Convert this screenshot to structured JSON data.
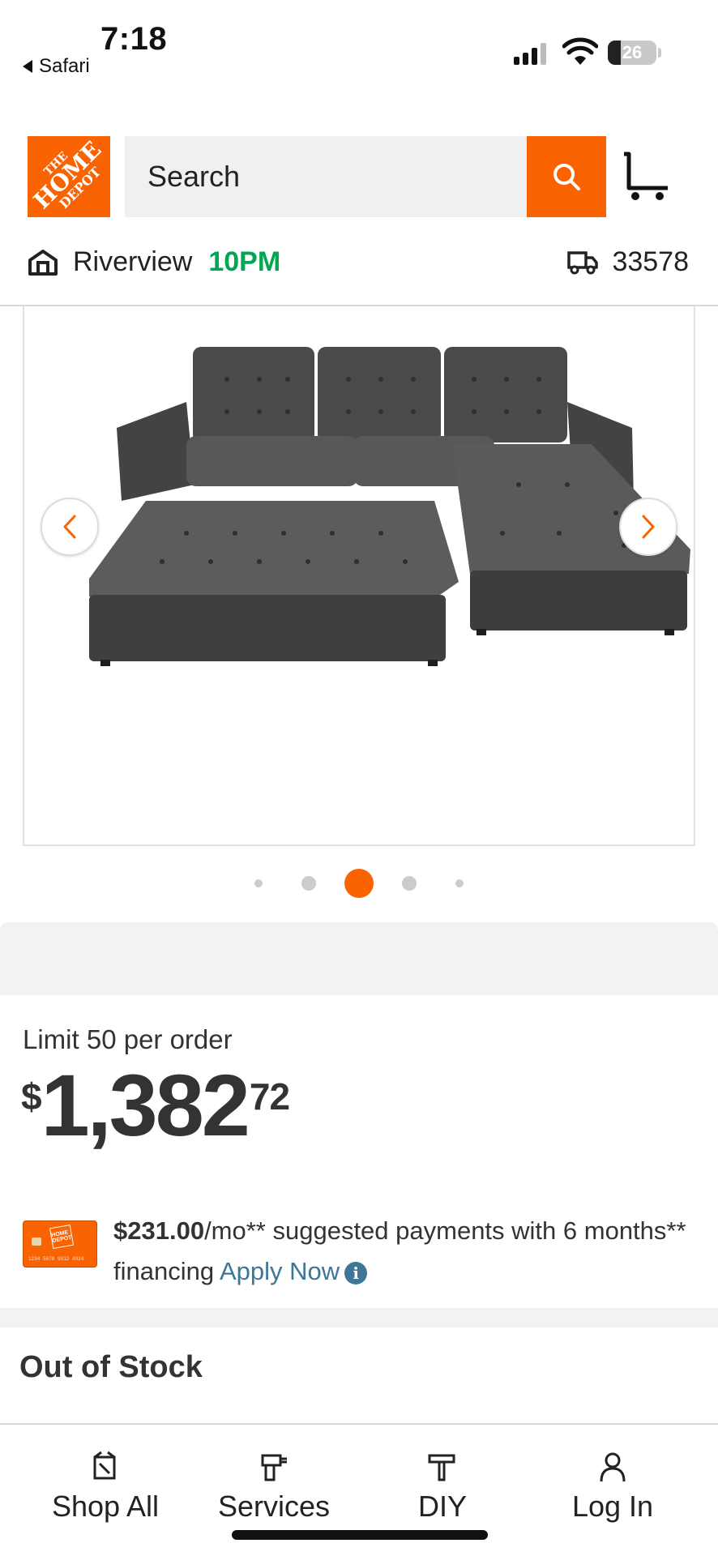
{
  "status_bar": {
    "time": "7:18",
    "back_app": "Safari",
    "battery": "26",
    "battery_level": 0.26
  },
  "header": {
    "logo": {
      "line1": "THE",
      "line2": "HOME",
      "line3": "DEPOT"
    },
    "search_placeholder": "Search",
    "store_name": "Riverview",
    "store_hours": "10PM",
    "zip": "33578"
  },
  "gallery": {
    "dot_count": 5,
    "active_index": 2
  },
  "pricing": {
    "limit": "Limit 50 per order",
    "currency": "$",
    "dollars": "1,382",
    "cents": "72"
  },
  "financing": {
    "card_number": "1234 5678 9012 4024",
    "card_logo": "HOME DEPOT",
    "amount": "$231.00",
    "text_after_amount": "/mo** suggested payments with 6 months** financing ",
    "apply_label": "Apply Now",
    "info_glyph": "i"
  },
  "stock": {
    "status": "Out of Stock"
  },
  "bottom_nav": {
    "items": [
      {
        "label": "Shop All",
        "icon": "shop-all-icon"
      },
      {
        "label": "Services",
        "icon": "drill-icon"
      },
      {
        "label": "DIY",
        "icon": "hammer-icon"
      },
      {
        "label": "Log In",
        "icon": "user-icon"
      }
    ]
  },
  "colors": {
    "brand_orange": "#f96302",
    "store_hours_green": "#00a651",
    "link_blue": "#3e7697"
  }
}
